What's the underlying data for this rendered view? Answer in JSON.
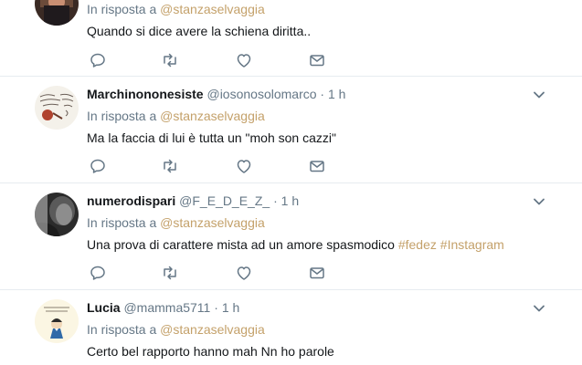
{
  "reply_prefix": "In risposta a",
  "reply_to": "@stanzaselvaggia",
  "tweets": [
    {
      "text": "Quando si dice avere la schiena diritta.."
    },
    {
      "name": "Marchinononesiste",
      "handle": "@iosonosolomarco",
      "separator": "·",
      "time": "1 h",
      "text": "Ma la faccia di lui  è tutta un \"moh son cazzi\""
    },
    {
      "name": "numerodispari",
      "handle": "@F_E_D_E_Z_",
      "separator": "·",
      "time": "1 h",
      "text": "Una prova di carattere mista ad un amore spasmodico",
      "hashtags": [
        "#fedez",
        "#Instagram"
      ]
    },
    {
      "name": "Lucia",
      "handle": "@mamma5711",
      "separator": "·",
      "time": "1 h",
      "text": "Certo bel rapporto hanno mah Nn ho parole"
    }
  ],
  "icons": [
    "reply-icon",
    "retweet-icon",
    "like-icon",
    "direct-message-icon",
    "chevron-down-icon"
  ],
  "colors": {
    "link": "#c4a16a",
    "muted": "#657786",
    "icon": "#657786",
    "border": "#e6ecf0"
  }
}
